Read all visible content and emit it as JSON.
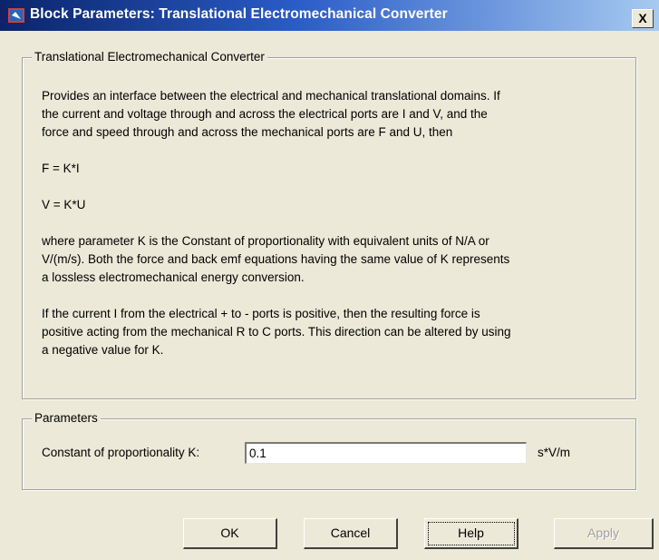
{
  "window": {
    "title": "Block Parameters: Translational Electromechanical Converter",
    "close_label": "X"
  },
  "description_group": {
    "legend": "Translational Electromechanical Converter",
    "lines": [
      "Provides an interface between the electrical and mechanical translational domains. If",
      "the current and voltage through and across the electrical ports are I and V, and the",
      "force and speed through and across the mechanical ports are F and U, then",
      "F = K*I",
      "V = K*U",
      "where parameter K is the Constant of proportionality with equivalent units of N/A or",
      "V/(m/s). Both the force and back emf equations having the same value of K represents",
      "a lossless electromechanical energy conversion.",
      "If the current I from the electrical + to - ports is positive, then the resulting force is",
      "positive acting from the mechanical R to C ports. This direction can be altered by using",
      "a negative value for K."
    ]
  },
  "parameters_group": {
    "legend": "Parameters",
    "k_label": "Constant of proportionality K:",
    "k_value": "0.1",
    "k_unit": "s*V/m"
  },
  "buttons": {
    "ok": "OK",
    "cancel": "Cancel",
    "help": "Help",
    "apply": "Apply"
  }
}
